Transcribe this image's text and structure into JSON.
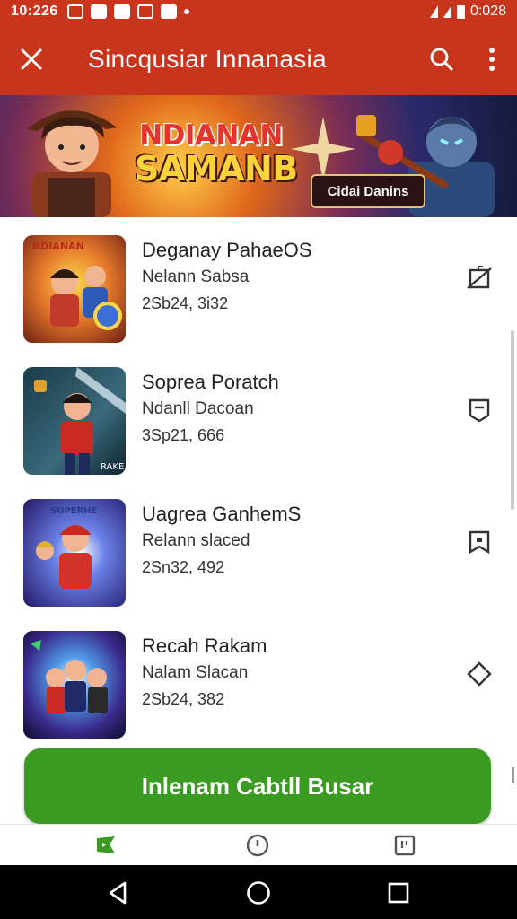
{
  "status_bar": {
    "time": "10:226",
    "right_time": "0:028"
  },
  "app_bar": {
    "title": "Sincqusiar Innanasia"
  },
  "banner": {
    "title_line1": "NDIANAN",
    "title_line2": "SAMANB",
    "badge": "Cidai Danins",
    "thumb_tag": "NDIANAN"
  },
  "items": [
    {
      "name": "Deganay PahaeOS",
      "subtitle": "Nelann Sabsa",
      "meta": "2Sb24, 3i32",
      "action_icon": "crossed-bookmark-icon",
      "thumb_tag": "NDIANAN"
    },
    {
      "name": "Soprea Poratch",
      "subtitle": "Ndanll Dacoan",
      "meta": "3Sp21, 666",
      "action_icon": "chat-bookmark-icon",
      "thumb_tag": "RAKE"
    },
    {
      "name": "Uagrea GanhemS",
      "subtitle": "Relann slaced",
      "meta": "2Sn32, 492",
      "action_icon": "save-bookmark-icon",
      "thumb_tag": "SUPERHE"
    },
    {
      "name": "Recah Rakam",
      "subtitle": "Nalam Slacan",
      "meta": "2Sb24, 382",
      "action_icon": "diamond-icon",
      "thumb_tag": ""
    }
  ],
  "cta": {
    "label": "Inlenam Cabtll Busar"
  },
  "colors": {
    "primary": "#c8351c",
    "accent": "#3a9a21"
  }
}
